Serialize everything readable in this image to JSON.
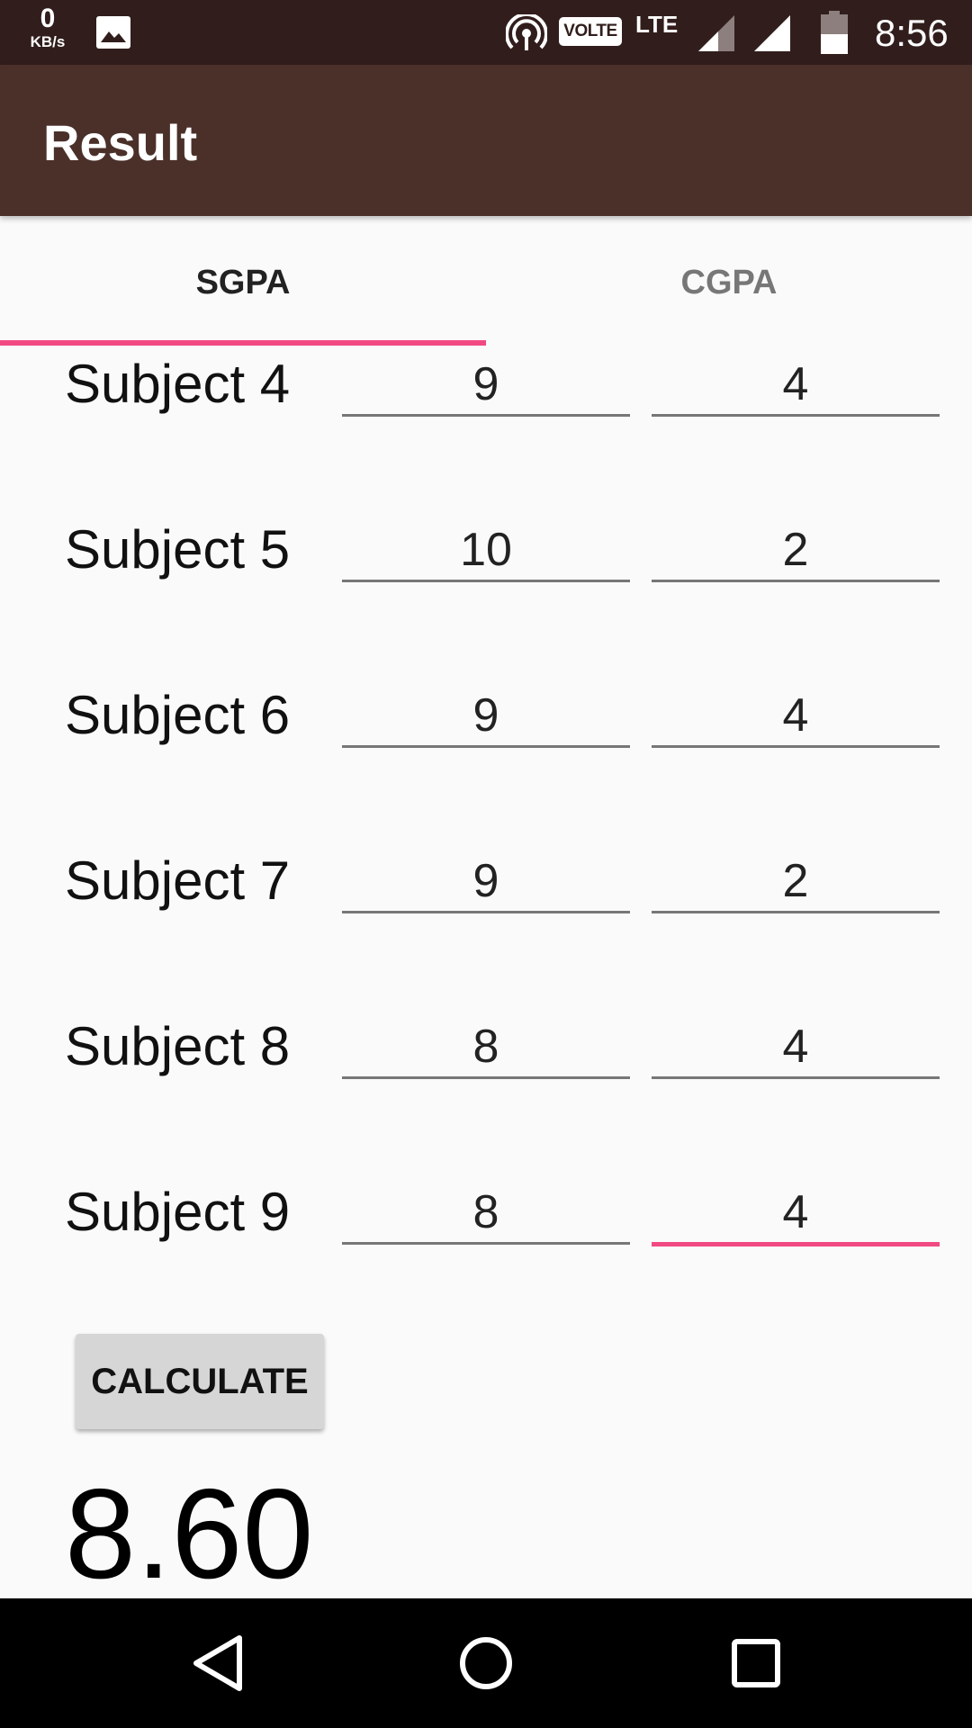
{
  "status_bar": {
    "net_speed": "0",
    "net_unit": "KB/s",
    "volte": "VOLTE",
    "network": "LTE",
    "time": "8:56",
    "icons": [
      "gallery-icon",
      "hotspot-icon",
      "signal-icon",
      "signal-icon",
      "battery-icon"
    ]
  },
  "app_bar": {
    "title": "Result"
  },
  "tabs": [
    {
      "label": "SGPA",
      "selected": true
    },
    {
      "label": "CGPA",
      "selected": false
    }
  ],
  "subjects": [
    {
      "label": "Subject 4",
      "grade": "9",
      "credit": "4"
    },
    {
      "label": "Subject 5",
      "grade": "10",
      "credit": "2"
    },
    {
      "label": "Subject 6",
      "grade": "9",
      "credit": "4"
    },
    {
      "label": "Subject 7",
      "grade": "9",
      "credit": "2"
    },
    {
      "label": "Subject 8",
      "grade": "8",
      "credit": "4"
    },
    {
      "label": "Subject 9",
      "grade": "8",
      "credit": "4"
    }
  ],
  "calculate_label": "CALCULATE",
  "result": "8.60",
  "colors": {
    "status_bar": "#311e1c",
    "app_bar": "#4b302a",
    "accent": "#f14a82",
    "background": "#fafafa"
  }
}
